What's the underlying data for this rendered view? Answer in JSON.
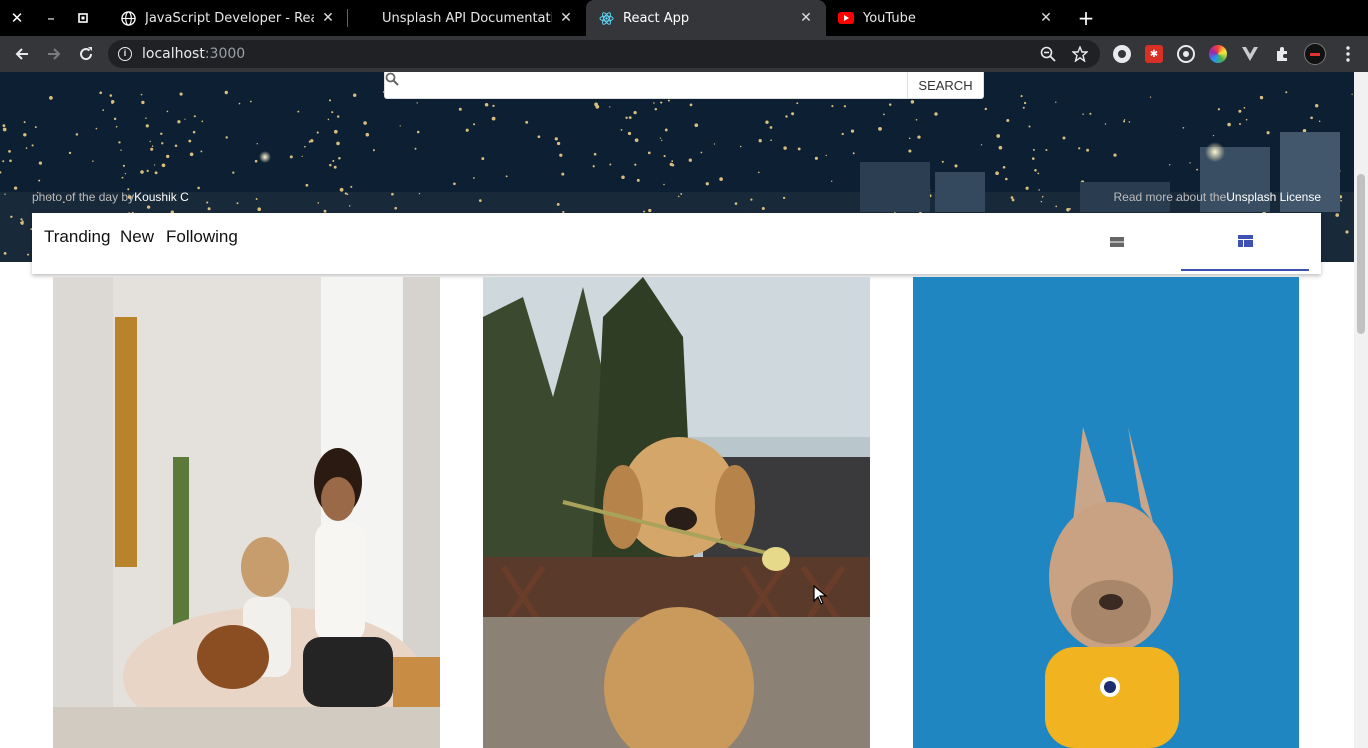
{
  "browser": {
    "tabs": [
      {
        "title": "JavaScript Developer - React.j",
        "favicon": "globe-icon",
        "active": false
      },
      {
        "title": "Unsplash API Documentation |",
        "favicon": "none",
        "active": false
      },
      {
        "title": "React App",
        "favicon": "react-icon",
        "active": true
      },
      {
        "title": "YouTube",
        "favicon": "youtube-icon",
        "active": false
      }
    ],
    "new_tab": "+",
    "url_host": "localhost",
    "url_port": ":3000"
  },
  "hero": {
    "search_placeholder": "",
    "search_button": "SEARCH",
    "credit_prefix": "photo of the day by",
    "credit_author": "Koushik C",
    "license_prefix": "Read more about the",
    "license_link": "Unsplash License"
  },
  "nav": {
    "links": [
      "Tranding",
      "New",
      "Following"
    ]
  },
  "photos": [
    {
      "subject": "two women with a dog on a bed",
      "color": "#d8d4ce"
    },
    {
      "subject": "golden retriever holding a flower",
      "color": "#7a6a58"
    },
    {
      "subject": "french bulldog in yellow sweater",
      "color": "#1e88c5"
    }
  ],
  "colors": {
    "accent": "#3f51b5"
  }
}
